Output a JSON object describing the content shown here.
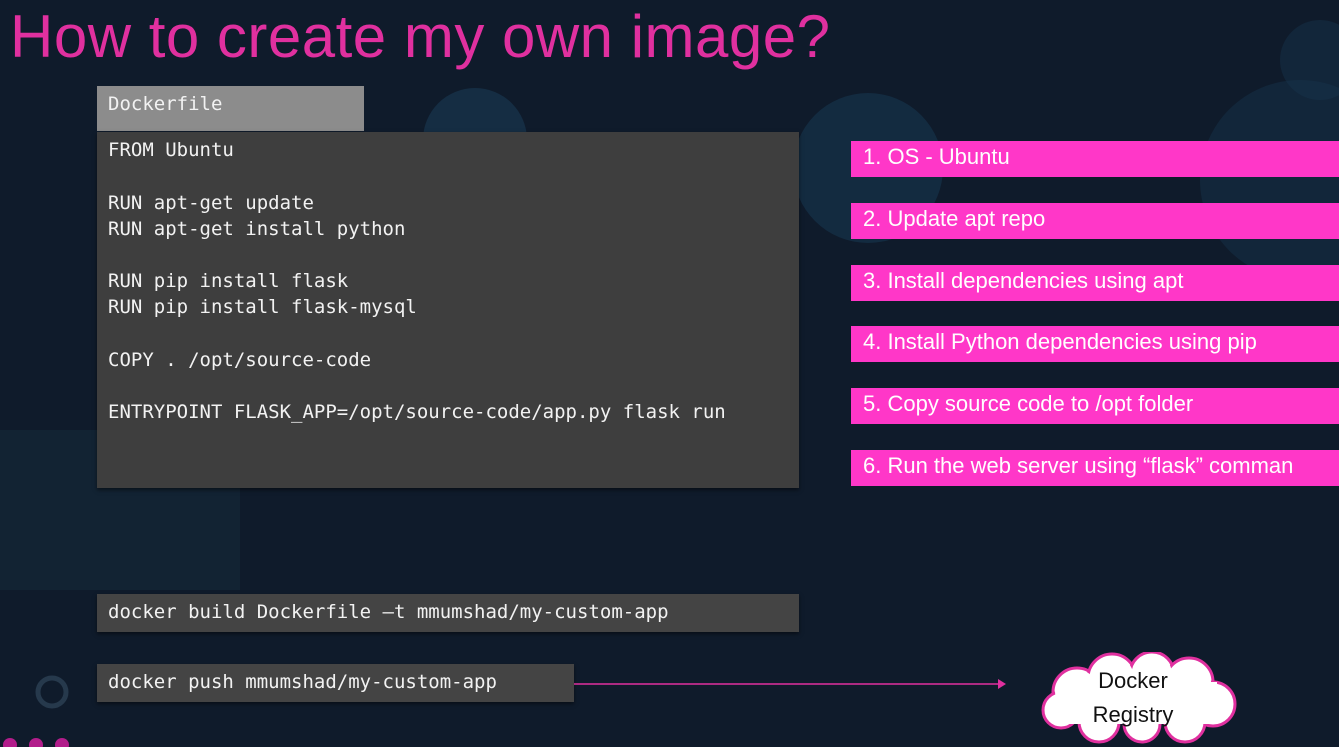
{
  "slide": {
    "title": "How to create my own image?"
  },
  "dockerfile": {
    "tab_label": "Dockerfile",
    "lines": [
      "FROM Ubuntu",
      "RUN apt-get update",
      "RUN apt-get install python",
      "RUN pip install flask",
      "RUN pip install flask-mysql",
      "COPY . /opt/source-code",
      "ENTRYPOINT FLASK_APP=/opt/source-code/app.py flask run"
    ]
  },
  "steps": [
    "1. OS - Ubuntu",
    "2. Update apt repo",
    "3. Install dependencies using apt",
    "4. Install Python dependencies using pip",
    "5. Copy source code to /opt folder",
    "6. Run the web server using “flask” comman"
  ],
  "commands": {
    "build": "docker build Dockerfile –t mmumshad/my-custom-app",
    "push": "docker push mmumshad/my-custom-app"
  },
  "registry": {
    "line1": "Docker",
    "line2": "Registry"
  },
  "colors": {
    "background": "#0f1b2b",
    "title": "#e0309f",
    "step_fill": "#ff37c8",
    "code_panel": "#3e3e3e",
    "tab": "#8c8c8c"
  }
}
